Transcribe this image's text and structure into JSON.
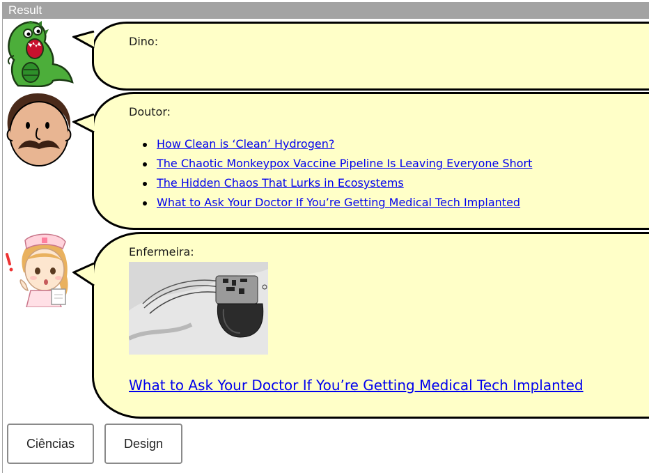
{
  "frame": {
    "title": "Result"
  },
  "chat": [
    {
      "speaker": "Dino:",
      "avatar": "dino-avatar"
    },
    {
      "speaker": "Doutor:",
      "avatar": "doctor-avatar",
      "links": [
        "How Clean is ‘Clean’ Hydrogen?",
        "The Chaotic Monkeypox Vaccine Pipeline Is Leaving Everyone Short",
        "The Hidden Chaos That Lurks in Ecosystems",
        "What to Ask Your Doctor If You’re Getting Medical Tech Implanted"
      ]
    },
    {
      "speaker": "Enfermeira:",
      "avatar": "nurse-avatar",
      "image": "pacemaker-xray-image",
      "link": "What to Ask Your Doctor If You’re Getting Medical Tech Implanted"
    }
  ],
  "buttons": {
    "ciencias": "Ciências",
    "design": "Design"
  },
  "colors": {
    "bubble": "#ffffc8",
    "link": "#0000ee",
    "header": "#a3a3a3"
  }
}
